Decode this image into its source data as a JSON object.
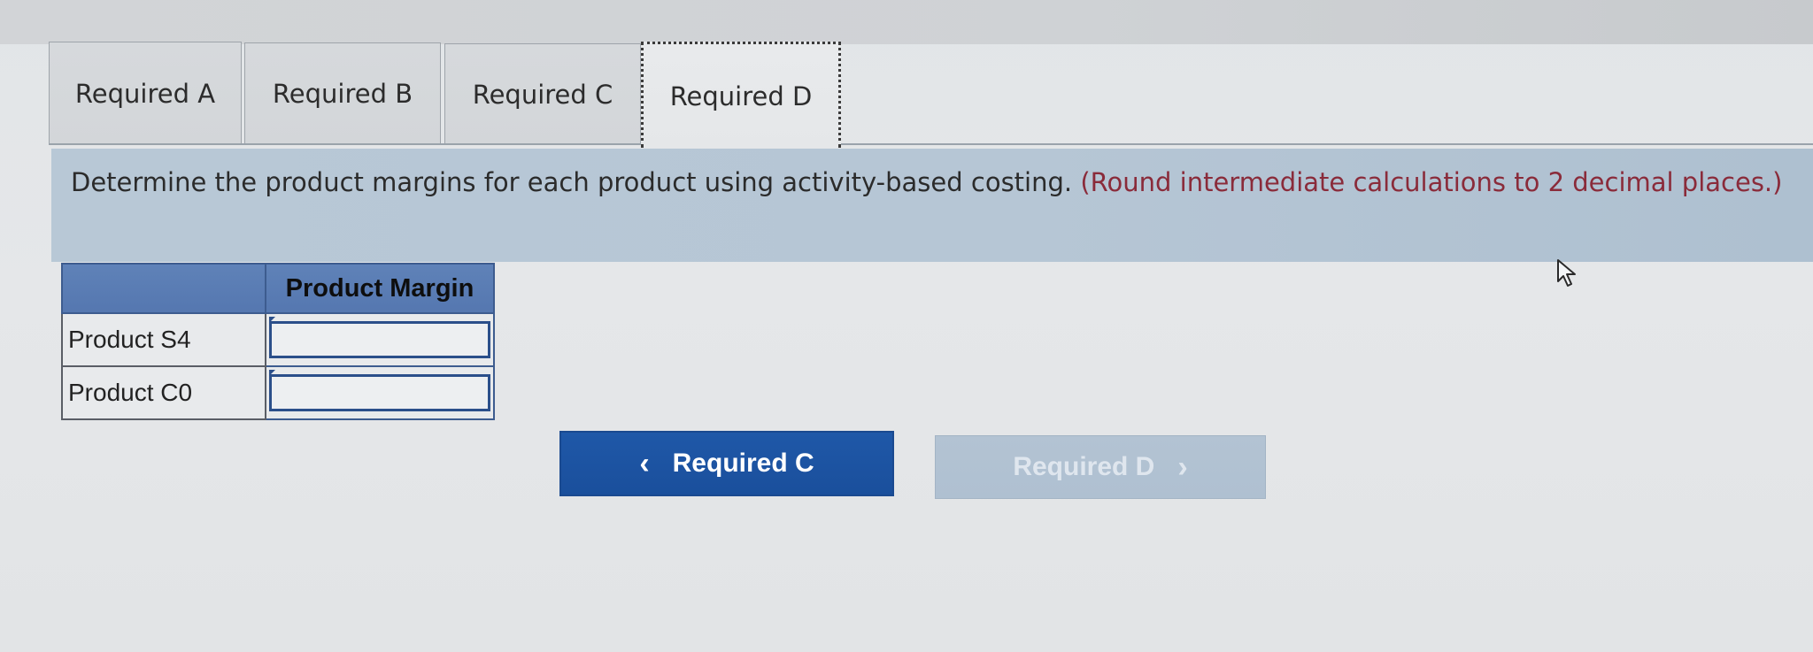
{
  "tabs": [
    {
      "label": "Required A",
      "active": false
    },
    {
      "label": "Required B",
      "active": false
    },
    {
      "label": "Required C",
      "active": false
    },
    {
      "label": "Required D",
      "active": true
    }
  ],
  "instruction": {
    "text": "Determine the product margins for each product using activity-based costing. ",
    "note": "(Round intermediate calculations to 2 decimal places.)"
  },
  "table": {
    "header_blank": "",
    "header": "Product Margin",
    "rows": [
      {
        "label": "Product S4",
        "value": ""
      },
      {
        "label": "Product C0",
        "value": ""
      }
    ]
  },
  "nav": {
    "prev_label": "Required C",
    "prev_icon": "chevron-left-icon",
    "next_label": "Required D",
    "next_icon": "chevron-right-icon",
    "next_disabled": true
  },
  "colors": {
    "accent": "#1f58a8",
    "instruction_bg": "#b8c8d6",
    "table_header": "#5f82b8",
    "note_text": "#8a2b3a"
  }
}
